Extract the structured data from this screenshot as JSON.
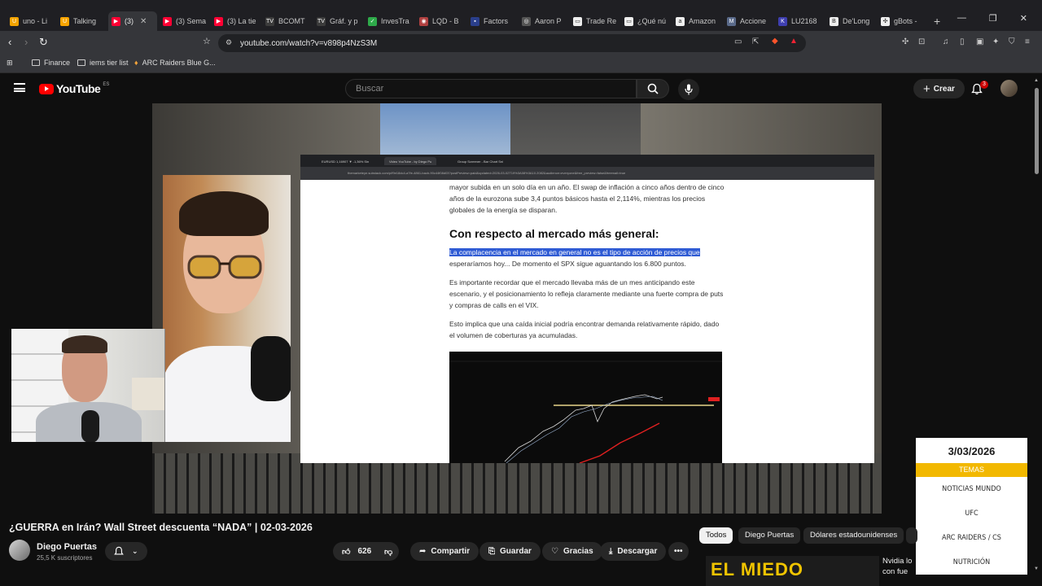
{
  "browser": {
    "tabs": [
      {
        "label": "uno - Li",
        "color": "#f4a400",
        "glyph": "U"
      },
      {
        "label": "Talking",
        "color": "#f9a500",
        "glyph": "U"
      },
      {
        "label": "(3)",
        "color": "#ff0033",
        "glyph": "▶"
      },
      {
        "label": "(3) Sema",
        "color": "#ff0033",
        "glyph": "▶"
      },
      {
        "label": "(3) La tie",
        "color": "#ff0033",
        "glyph": "▶"
      },
      {
        "label": "BCOMT",
        "color": "#3b3b3b",
        "glyph": "TV"
      },
      {
        "label": "Gráf. y p",
        "color": "#3b3b3b",
        "glyph": "TV"
      },
      {
        "label": "InvesTra",
        "color": "#2eaa4a",
        "glyph": "✓"
      },
      {
        "label": "LQD - B",
        "color": "#b04040",
        "glyph": "◉"
      },
      {
        "label": "Factors",
        "color": "#2a3f8c",
        "glyph": "▪"
      },
      {
        "label": "Aaron P",
        "color": "#555555",
        "glyph": "◎"
      },
      {
        "label": "Trade Re",
        "color": "#eeeeee",
        "glyph": "▭"
      },
      {
        "label": "¿Qué nú",
        "color": "#eeeeee",
        "glyph": "▭"
      },
      {
        "label": "Amazon",
        "color": "#eeeeee",
        "glyph": "a"
      },
      {
        "label": "Accione",
        "color": "#5a6a8a",
        "glyph": "M"
      },
      {
        "label": "LU2168",
        "color": "#3f3fb0",
        "glyph": "K"
      },
      {
        "label": "De'Long",
        "color": "#eeeeee",
        "glyph": "B"
      },
      {
        "label": "gBots -",
        "color": "#eeeeee",
        "glyph": "✣"
      }
    ],
    "active_tab_index": 2,
    "new_tab": "+",
    "url": "youtube.com/watch?v=v898p4NzS3M",
    "bookmarks": [
      {
        "label": "Finance",
        "icon": "folder-icon"
      },
      {
        "label": "iems tier list",
        "icon": "folder-icon"
      },
      {
        "label": "ARC Raiders Blue G...",
        "icon": "arc-icon"
      }
    ]
  },
  "youtube": {
    "logo_word": "YouTube",
    "country": "ES",
    "search_placeholder": "Buscar",
    "create_label": "Crear",
    "notification_count": "3"
  },
  "screen_share": {
    "tabs": [
      "EURUSD 1,16907 ▼ -1,36% Sin",
      "Video YouTube - by Diego Pu",
      "Group Screener - Bar Chart Sni"
    ],
    "address": "themarketeye.substack.com/p/f9e18dc4-a7fe-4861-bacb-90c44f08d03?postPreview=paid&updated=2026-03-02T19%3A08%3A10.2082&audience=everyone&free_preview=false&freemail=true",
    "para1": "mayor subida en un solo día en un año. El swap de inflación a cinco años dentro de cinco años de la eurozona sube 3,4 puntos básicos hasta el 2,114%, mientras los precios globales de la energía se disparan.",
    "heading": "Con respecto al mercado más general:",
    "highlight": "La complacencia en el mercado en general no es el tipo de acción de precios que",
    "para2_rest": " esperaríamos hoy... De momento el SPX sigue aguantando los 6.800 puntos.",
    "para3": "Es importante recordar que el mercado llevaba más de un mes anticipando este escenario, y el posicionamiento lo refleja claramente mediante una fuerte compra de puts y compras de calls en el VIX.",
    "para4": "Esto implica que una caída inicial podría encontrar demanda relativamente rápido, dado el volumen de coberturas ya acumuladas."
  },
  "overlay": {
    "date": "3/03/2026",
    "topics_header": "TEMAS",
    "topics": [
      "NOTICIAS MUNDO",
      "UFC",
      "ARC RAIDERS / CS",
      "NUTRICIÓN"
    ],
    "accent_color": "#f2b800"
  },
  "video": {
    "title": "¿GUERRA en Irán? Wall Street descuenta “NADA” | 02-03-2026",
    "channel": "Diego Puertas",
    "subscribers": "25,5 K suscriptores",
    "likes": "626",
    "share_label": "Compartir",
    "save_label": "Guardar",
    "thanks_label": "Gracias",
    "download_label": "Descargar"
  },
  "chips": [
    "Todos",
    "Diego Puertas",
    "Dólares estadounidenses"
  ],
  "recommended": {
    "thumb_text": "EL MIEDO",
    "title": "Nvidia lo con fue exage"
  }
}
